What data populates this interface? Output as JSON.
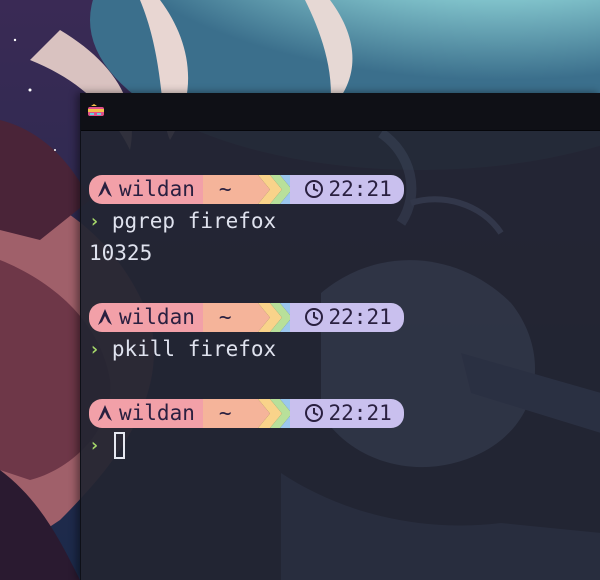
{
  "terminal": {
    "prompts": [
      {
        "user": "wildan",
        "dir": "~",
        "time": "22:21",
        "command": "pgrep firefox",
        "output": "10325"
      },
      {
        "user": "wildan",
        "dir": "~",
        "time": "22:21",
        "command": "pkill firefox",
        "output": ""
      },
      {
        "user": "wildan",
        "dir": "~",
        "time": "22:21",
        "command": "",
        "output": ""
      }
    ],
    "prompt_symbol": "›"
  },
  "colors": {
    "user_segment": "#f2a0a8",
    "dir_segment": "#f5b49a",
    "arrow_colors": [
      "#f9d38a",
      "#b8e09a",
      "#9cc7ee"
    ],
    "time_segment": "#c9c0ee",
    "prompt_symbol": "#a6d96a",
    "text": "#dfe2ee"
  },
  "icons": {
    "os": "arch-linux-icon",
    "clock": "clock-icon",
    "app": "terminal-app-icon"
  }
}
